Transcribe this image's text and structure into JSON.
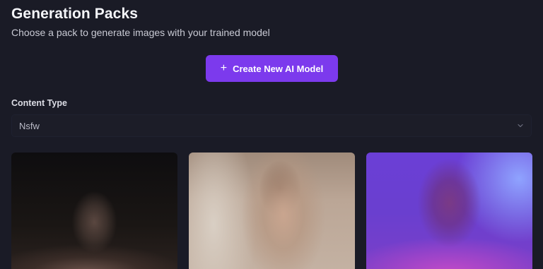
{
  "header": {
    "title": "Generation Packs",
    "subtitle": "Choose a pack to generate images with your trained model"
  },
  "actions": {
    "create_label": "Create New AI Model",
    "create_icon": "plus-icon"
  },
  "filter": {
    "label": "Content Type",
    "selected": "Nsfw",
    "icon": "chevron-down-icon"
  },
  "packs": [
    {
      "image": "pack-thumbnail-1"
    },
    {
      "image": "pack-thumbnail-2"
    },
    {
      "image": "pack-thumbnail-3"
    }
  ],
  "colors": {
    "background": "#1a1b26",
    "accent": "#7c3aed"
  }
}
